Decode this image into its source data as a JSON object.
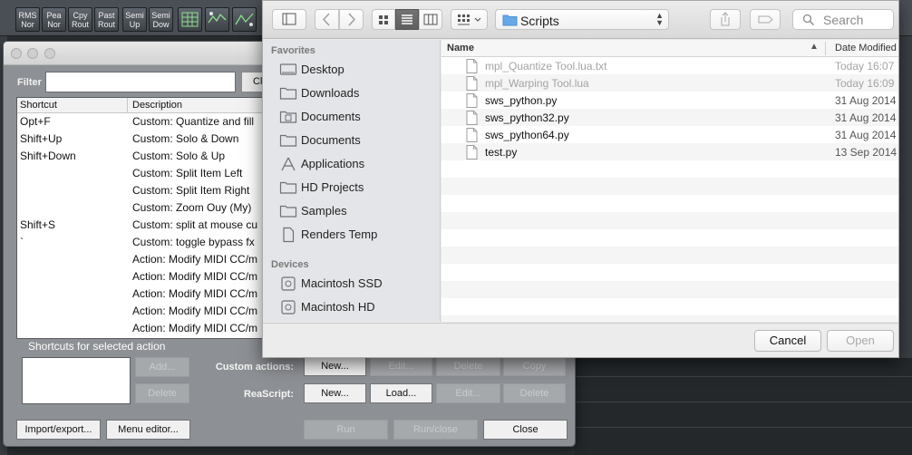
{
  "reaper_toolbar": {
    "buttons": [
      {
        "line1": "RMS",
        "line2": "Nor"
      },
      {
        "line1": "Pea",
        "line2": "Nor"
      },
      {
        "line1": "Cpy",
        "line2": "Rout"
      },
      {
        "line1": "Past",
        "line2": "Rout"
      },
      {
        "line1": "Semi",
        "line2": "Up"
      },
      {
        "line1": "Semi",
        "line2": "Dow"
      }
    ]
  },
  "action_window": {
    "filter_label": "Filter",
    "filter_value": "",
    "clear_label": "Cl",
    "columns": {
      "shortcut": "Shortcut",
      "description": "Description"
    },
    "rows": [
      {
        "shortcut": "Opt+F",
        "description": "Custom: Quantize and fill"
      },
      {
        "shortcut": "Shift+Up",
        "description": "Custom: Solo & Down"
      },
      {
        "shortcut": "Shift+Down",
        "description": "Custom: Solo & Up"
      },
      {
        "shortcut": "",
        "description": "Custom: Split Item Left"
      },
      {
        "shortcut": "",
        "description": "Custom: Split Item Right"
      },
      {
        "shortcut": "",
        "description": "Custom: Zoom Ouy (My)"
      },
      {
        "shortcut": "Shift+S",
        "description": "Custom: split at mouse cu"
      },
      {
        "shortcut": "`",
        "description": "Custom: toggle bypass fx"
      },
      {
        "shortcut": "",
        "description": "Action: Modify MIDI CC/m"
      },
      {
        "shortcut": "",
        "description": "Action: Modify MIDI CC/m"
      },
      {
        "shortcut": "",
        "description": "Action: Modify MIDI CC/m"
      },
      {
        "shortcut": "",
        "description": "Action: Modify MIDI CC/m"
      },
      {
        "shortcut": "",
        "description": "Action: Modify MIDI CC/m"
      }
    ],
    "shortcuts_label": "Shortcuts for selected action",
    "add_label": "Add...",
    "delete_label": "Delete",
    "custom_actions_label": "Custom actions:",
    "reascript_label": "ReaScript:",
    "ca_buttons": [
      "New...",
      "Edit...",
      "Delete",
      "Copy"
    ],
    "rs_buttons": [
      "New...",
      "Load...",
      "Edit...",
      "Delete"
    ],
    "import_export_label": "Import/export...",
    "menu_editor_label": "Menu editor...",
    "run_label": "Run",
    "run_close_label": "Run/close",
    "close_label": "Close"
  },
  "file_dialog": {
    "location": "Scripts",
    "search_placeholder": "Search",
    "sidebar": {
      "favorites_label": "Favorites",
      "favorites": [
        {
          "label": "Desktop",
          "icon": "desktop-icon"
        },
        {
          "label": "Downloads",
          "icon": "folder-icon"
        },
        {
          "label": "Documents",
          "icon": "document-folder-icon"
        },
        {
          "label": "Documents",
          "icon": "folder-icon"
        },
        {
          "label": "Applications",
          "icon": "applications-icon"
        },
        {
          "label": "HD Projects",
          "icon": "folder-icon"
        },
        {
          "label": "Samples",
          "icon": "folder-icon"
        },
        {
          "label": "Renders Temp",
          "icon": "file-icon"
        }
      ],
      "devices_label": "Devices",
      "devices": [
        {
          "label": "Macintosh SSD",
          "icon": "drive-icon"
        },
        {
          "label": "Macintosh HD",
          "icon": "drive-icon"
        }
      ]
    },
    "columns": {
      "name": "Name",
      "date": "Date Modified"
    },
    "files": [
      {
        "name": "mpl_Quantize Tool.lua.txt",
        "date": "Today 16:07",
        "enabled": false
      },
      {
        "name": "mpl_Warping Tool.lua",
        "date": "Today 16:09",
        "enabled": false
      },
      {
        "name": "sws_python.py",
        "date": "31 Aug 2014",
        "enabled": true
      },
      {
        "name": "sws_python32.py",
        "date": "31 Aug 2014",
        "enabled": true
      },
      {
        "name": "sws_python64.py",
        "date": "31 Aug 2014",
        "enabled": true
      },
      {
        "name": "test.py",
        "date": "13 Sep 2014",
        "enabled": true
      }
    ],
    "cancel_label": "Cancel",
    "open_label": "Open"
  }
}
